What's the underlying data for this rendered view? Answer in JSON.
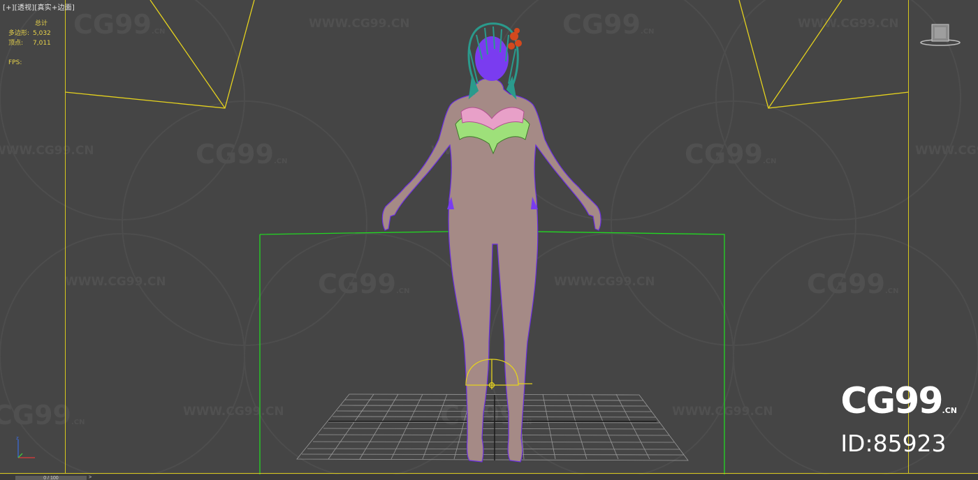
{
  "viewport": {
    "label": "[+][透视][真实+边面]"
  },
  "stats": {
    "title": "总计",
    "polys_label": "多边形:",
    "polys_value": "5,032",
    "verts_label": "顶点:",
    "verts_value": "7,011",
    "fps_label": "FPS:"
  },
  "watermark": {
    "logo_text": "CG99",
    "logo_suffix": ".CN",
    "url_text": "WWW.CG99.CN"
  },
  "brand": {
    "logo": "CG99",
    "logo_suffix": ".CN",
    "id_text": "ID:85923"
  },
  "timeline": {
    "slider_text": "0 / 100",
    "arrow": ">"
  },
  "colors": {
    "background": "#454545",
    "safe_frame": "#d8c81c",
    "selection_box": "#22d822",
    "wireframe": "#7a3cf0",
    "skin": "#a58a86",
    "hair": "#2a9a8c",
    "flower": "#d3491e",
    "bikini_ruffle": "#9ee07a",
    "bikini_flowers": "#e8a0c8",
    "grid": "#9a9a9a",
    "stats_text": "#e8d34a"
  }
}
